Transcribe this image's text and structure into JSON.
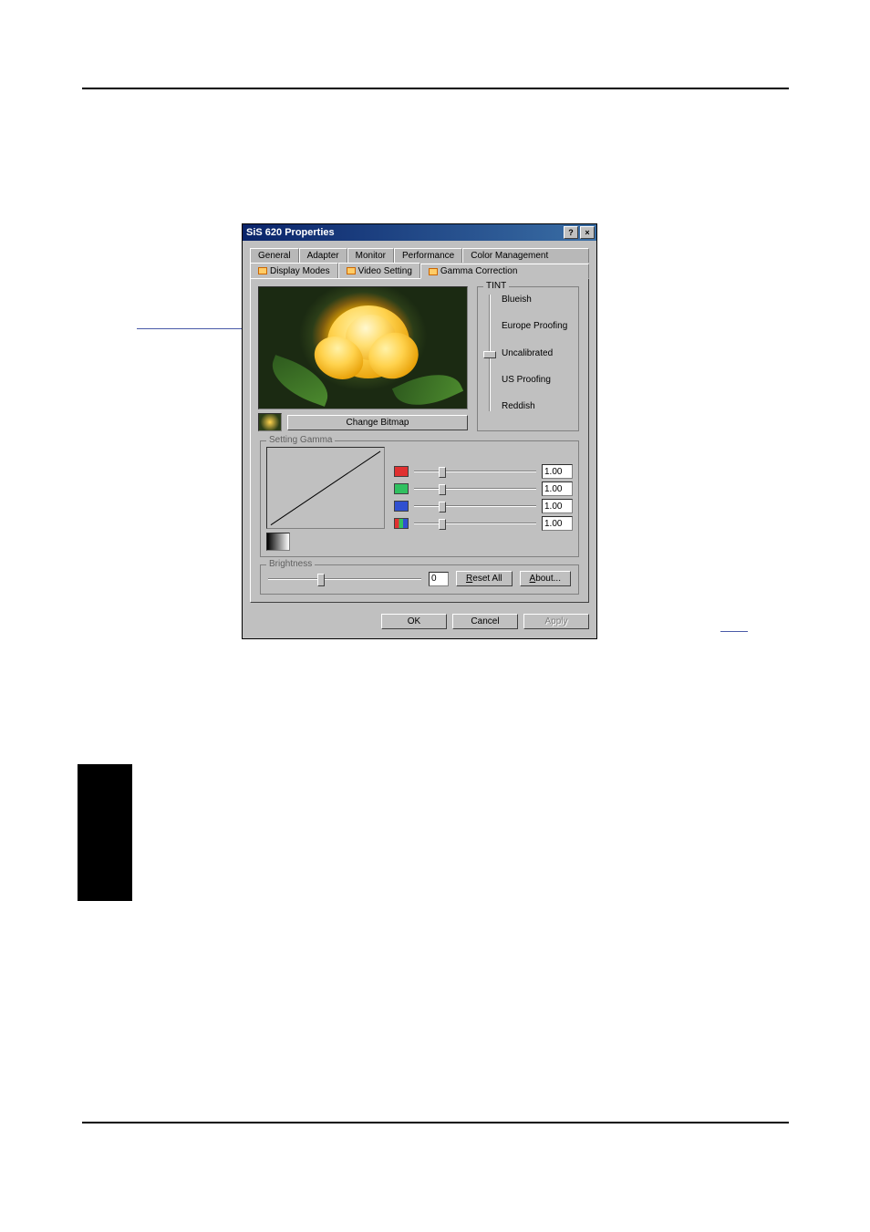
{
  "window": {
    "title": "SiS 620 Properties"
  },
  "tabs_row1": {
    "general": "General",
    "adapter": "Adapter",
    "monitor": "Monitor",
    "performance": "Performance",
    "color_management": "Color Management"
  },
  "tabs_row2": {
    "display_modes": "Display Modes",
    "video_setting": "Video Setting",
    "gamma_correction": "Gamma Correction"
  },
  "bitmap": {
    "change_button": "Change Bitmap"
  },
  "tint": {
    "group": "TINT",
    "items": {
      "blueish": "Blueish",
      "europe_proofing": "Europe Proofing",
      "uncalibrated": "Uncalibrated",
      "us_proofing": "US Proofing",
      "reddish": "Reddish"
    }
  },
  "gamma": {
    "group": "Setting Gamma",
    "red": "1.00",
    "green": "1.00",
    "blue": "1.00",
    "all": "1.00"
  },
  "brightness": {
    "group": "Brightness",
    "value": "0",
    "reset": "Reset All",
    "about": "About..."
  },
  "dialog": {
    "ok": "OK",
    "cancel": "Cancel",
    "apply": "Apply"
  }
}
